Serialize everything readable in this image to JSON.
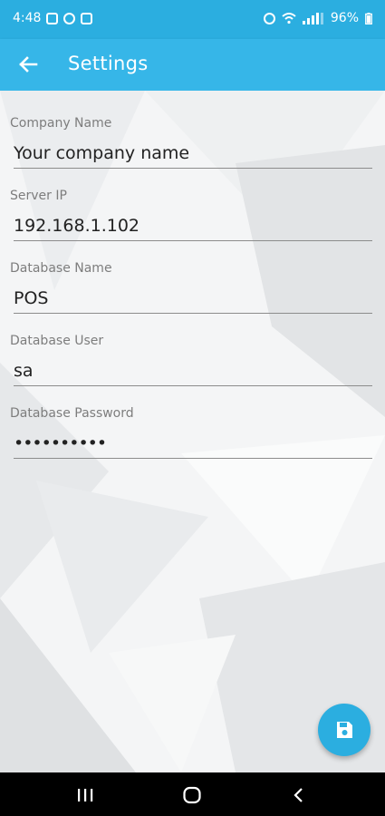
{
  "status_bar": {
    "time": "4:48",
    "battery": "96%"
  },
  "app_bar": {
    "title": "Settings",
    "back_icon": "arrow-left-icon"
  },
  "form": {
    "fields": [
      {
        "label": "Company Name",
        "value": "Your company name"
      },
      {
        "label": "Server IP",
        "value": "192.168.1.102"
      },
      {
        "label": "Database Name",
        "value": "POS"
      },
      {
        "label": "Database User",
        "value": "sa"
      },
      {
        "label": "Database Password",
        "value": "••••••••••"
      }
    ]
  },
  "fab": {
    "icon": "save-icon"
  },
  "colors": {
    "accent": "#2baee0",
    "appbar": "#36b6e8"
  }
}
